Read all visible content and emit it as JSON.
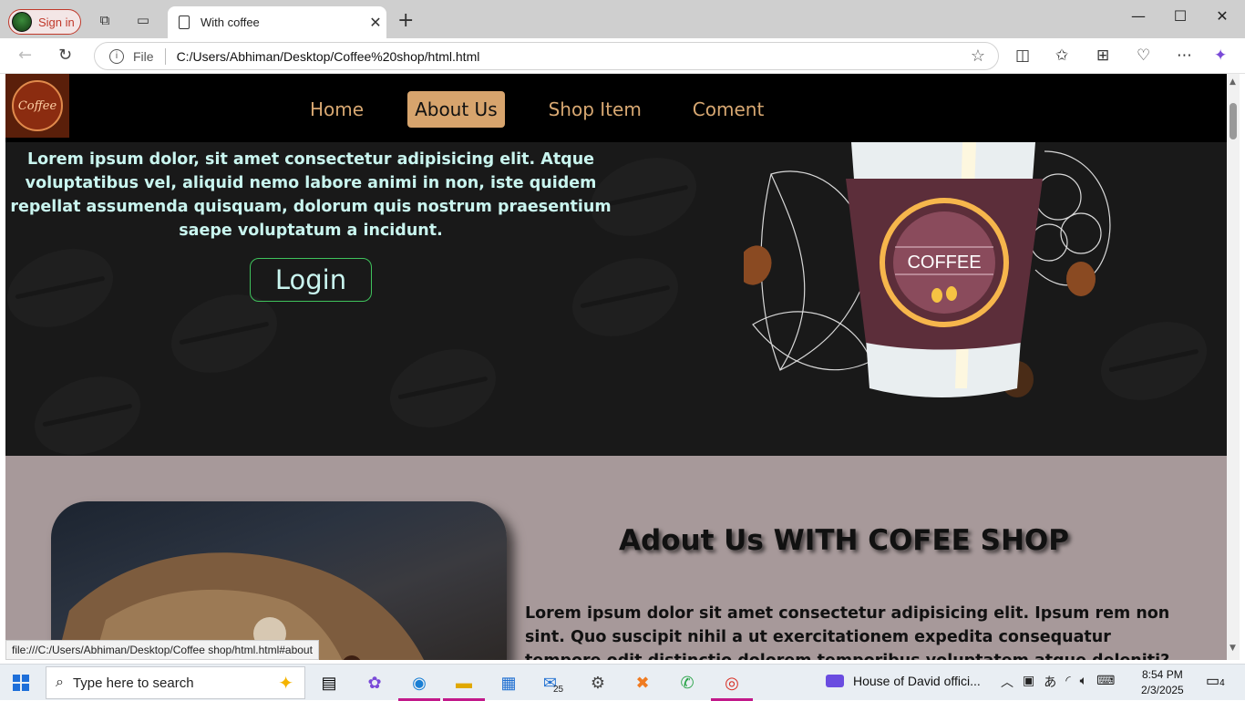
{
  "browser": {
    "profile_label": "Sign in",
    "tab_title": "With coffee",
    "url_scheme_label": "File",
    "url": "C:/Users/Abhiman/Desktop/Coffee%20shop/html.html",
    "status_url": "file:///C:/Users/Abhiman/Desktop/Coffee shop/html.html#about"
  },
  "site": {
    "logo_text": "Coffee",
    "nav": [
      {
        "label": "Home"
      },
      {
        "label": "About Us"
      },
      {
        "label": "Shop Item"
      },
      {
        "label": "Coment"
      }
    ],
    "hero": {
      "paragraph": "Lorem ipsum dolor, sit amet consectetur adipisicing elit. Atque voluptatibus vel, aliquid nemo labore animi in non, iste quidem repellat assumenda quisquam, dolorum quis nostrum praesentium saepe voluptatum a incidunt.",
      "login_label": "Login",
      "cup_label": "COFFEE"
    },
    "about": {
      "title": "Adout Us WITH COFEE SHOP",
      "paragraph": "Lorem ipsum dolor sit amet consectetur adipisicing elit. Ipsum rem non sint. Quo suscipit nihil a ut exercitationem expedita consequatur tempore odit distinctio dolorem temporibus voluptatem atque deleniti?"
    }
  },
  "taskbar": {
    "search_placeholder": "Type here to search",
    "mail_badge": "25",
    "media_title": "House of David offici...",
    "time": "8:54 PM",
    "date": "2/3/2025",
    "notification_count": "4"
  },
  "colors": {
    "nav_active_bg": "#d7a46d",
    "nav_text": "#d8a872",
    "hero_bg": "#191919",
    "about_bg": "#a7999a",
    "login_border": "#3fc25c"
  }
}
